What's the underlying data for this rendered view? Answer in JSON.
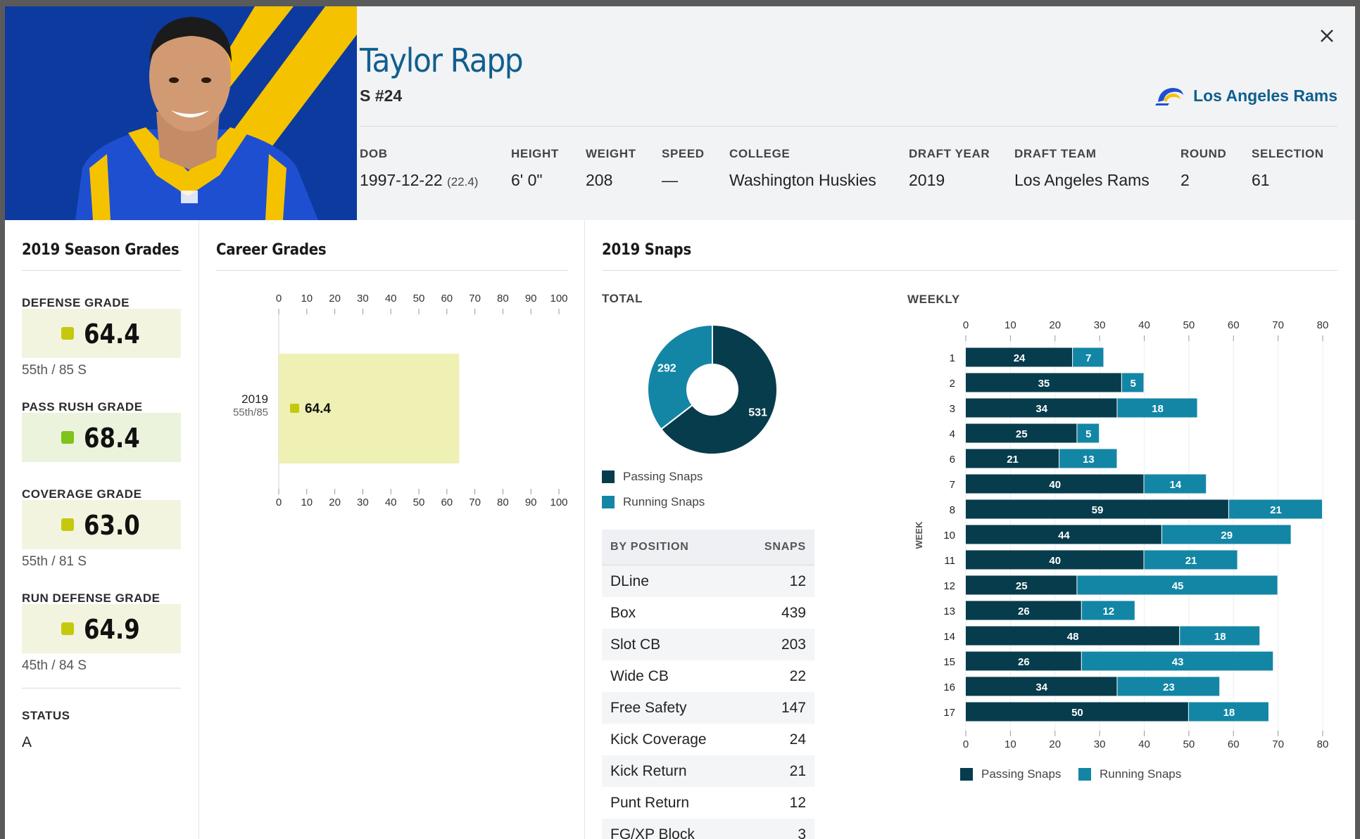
{
  "player": {
    "name": "Taylor Rapp",
    "position_number": "S #24",
    "team": "Los Angeles Rams"
  },
  "facts": [
    {
      "label": "DOB",
      "value": "1997-12-22",
      "extra": "(22.4)"
    },
    {
      "label": "HEIGHT",
      "value": "6' 0\""
    },
    {
      "label": "WEIGHT",
      "value": "208"
    },
    {
      "label": "SPEED",
      "value": "—"
    },
    {
      "label": "COLLEGE",
      "value": "Washington Huskies"
    },
    {
      "label": "DRAFT YEAR",
      "value": "2019"
    },
    {
      "label": "DRAFT TEAM",
      "value": "Los Angeles Rams"
    },
    {
      "label": "ROUND",
      "value": "2"
    },
    {
      "label": "SELECTION",
      "value": "61"
    }
  ],
  "season_grades": {
    "title": "2019 Season Grades",
    "grades": [
      {
        "label": "DEFENSE GRADE",
        "value": "64.4",
        "rank": "55th / 85 S",
        "color": "#c5c90e"
      },
      {
        "label": "PASS RUSH GRADE",
        "value": "68.4",
        "rank": "",
        "color": "#7fc31c"
      },
      {
        "label": "COVERAGE GRADE",
        "value": "63.0",
        "rank": "55th / 81 S",
        "color": "#c5c90e"
      },
      {
        "label": "RUN DEFENSE GRADE",
        "value": "64.9",
        "rank": "45th / 84 S",
        "color": "#c5c90e"
      }
    ],
    "status_label": "STATUS",
    "status_value": "A"
  },
  "career_grades": {
    "title": "Career Grades",
    "chart_data": {
      "type": "bar",
      "orientation": "horizontal",
      "categories": [
        "2019"
      ],
      "category_sublabels": [
        "55th/85"
      ],
      "values": [
        64.4
      ],
      "value_labels": [
        "64.4"
      ],
      "xlim": [
        0,
        100
      ],
      "xticks": [
        0,
        10,
        20,
        30,
        40,
        50,
        60,
        70,
        80,
        90,
        100
      ],
      "bar_color": "#eef0b4",
      "marker_color": "#c5c90e"
    }
  },
  "snaps": {
    "title": "2019 Snaps",
    "total_label": "TOTAL",
    "weekly_label": "WEEKLY",
    "legend": [
      "Passing Snaps",
      "Running Snaps"
    ],
    "colors": {
      "passing": "#073c4c",
      "running": "#1386a6"
    },
    "total_chart": {
      "type": "pie",
      "labels": [
        "Passing Snaps",
        "Running Snaps"
      ],
      "values": [
        531,
        292
      ]
    },
    "by_position": {
      "header_position": "BY POSITION",
      "header_snaps": "SNAPS",
      "rows": [
        {
          "position": "DLine",
          "snaps": "12"
        },
        {
          "position": "Box",
          "snaps": "439"
        },
        {
          "position": "Slot CB",
          "snaps": "203"
        },
        {
          "position": "Wide CB",
          "snaps": "22"
        },
        {
          "position": "Free Safety",
          "snaps": "147"
        },
        {
          "position": "Kick Coverage",
          "snaps": "24"
        },
        {
          "position": "Kick Return",
          "snaps": "21"
        },
        {
          "position": "Punt Return",
          "snaps": "12"
        },
        {
          "position": "FG/XP Block",
          "snaps": "3"
        }
      ]
    },
    "weekly_chart": {
      "type": "bar",
      "orientation": "horizontal",
      "stacked": true,
      "ylabel": "WEEK",
      "categories": [
        "1",
        "2",
        "3",
        "4",
        "6",
        "7",
        "8",
        "10",
        "11",
        "12",
        "13",
        "14",
        "15",
        "16",
        "17"
      ],
      "series": [
        {
          "name": "Passing Snaps",
          "values": [
            24,
            35,
            34,
            25,
            21,
            40,
            59,
            44,
            40,
            25,
            26,
            48,
            26,
            34,
            50
          ]
        },
        {
          "name": "Running Snaps",
          "values": [
            7,
            5,
            18,
            5,
            13,
            14,
            21,
            29,
            21,
            45,
            12,
            18,
            43,
            23,
            18
          ]
        }
      ],
      "xlim": [
        0,
        80
      ],
      "xticks": [
        0,
        10,
        20,
        30,
        40,
        50,
        60,
        70,
        80
      ]
    }
  }
}
